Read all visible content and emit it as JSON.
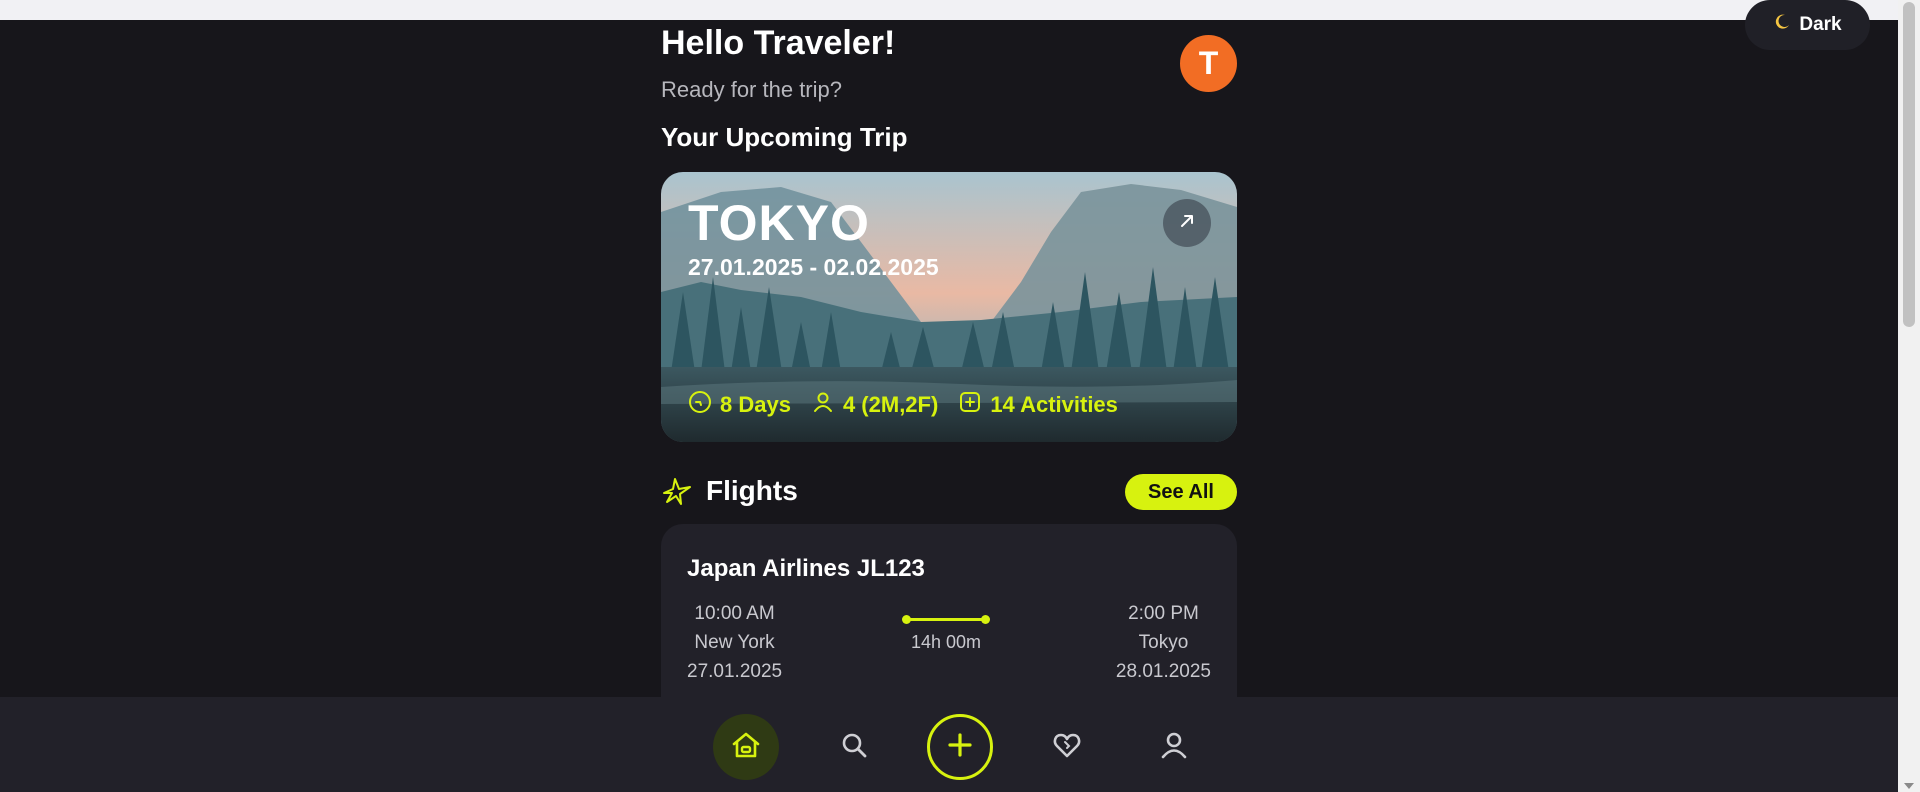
{
  "theme_toggle": {
    "icon": "moon-icon",
    "label": "Dark"
  },
  "header": {
    "greeting": "Hello Traveler!",
    "subtitle": "Ready for the trip?",
    "avatar_initial": "T"
  },
  "upcoming": {
    "section_title": "Your Upcoming Trip",
    "city": "TOKYO",
    "dates": "27.01.2025 - 02.02.2025",
    "stats": [
      {
        "icon": "clock-icon",
        "label": "8 Days"
      },
      {
        "icon": "person-icon",
        "label": "4 (2M,2F)"
      },
      {
        "icon": "plus-square-icon",
        "label": "14 Activities"
      }
    ]
  },
  "flights": {
    "title": "Flights",
    "see_all": "See All",
    "card": {
      "airline": "Japan Airlines JL123",
      "departure": {
        "time": "10:00 AM",
        "city": "New York",
        "date": "27.01.2025"
      },
      "arrival": {
        "time": "2:00 PM",
        "city": "Tokyo",
        "date": "28.01.2025"
      },
      "duration": "14h 00m"
    }
  },
  "bottom_nav": [
    "home-icon",
    "search-icon",
    "add-icon",
    "heart-icon",
    "profile-icon"
  ],
  "colors": {
    "accent": "#d7f20f",
    "avatar": "#f26d24",
    "background": "#17161b",
    "card": "#222129"
  }
}
